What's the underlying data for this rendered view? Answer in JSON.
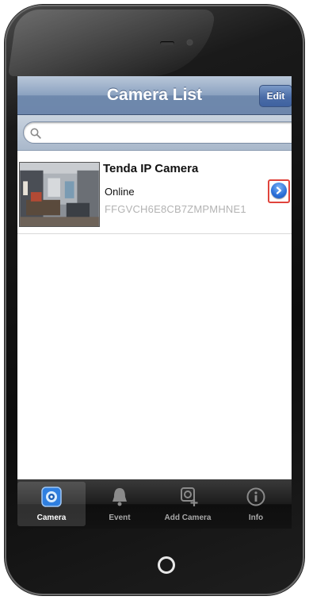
{
  "navbar": {
    "title": "Camera List",
    "edit_label": "Edit"
  },
  "search": {
    "placeholder": "",
    "value": ""
  },
  "cameras": [
    {
      "name": "Tenda IP Camera",
      "status": "Online",
      "id": "FFGVCH6E8CB7ZMPMHNE1"
    }
  ],
  "tabs": [
    {
      "label": "Camera",
      "icon": "camera-icon",
      "selected": true
    },
    {
      "label": "Event",
      "icon": "bell-icon",
      "selected": false
    },
    {
      "label": "Add Camera",
      "icon": "add-camera-icon",
      "selected": false
    },
    {
      "label": "Info",
      "icon": "info-icon",
      "selected": false
    }
  ],
  "colors": {
    "accent": "#2a6fd8",
    "highlight": "#e0443c",
    "navbar": "#7f97b9"
  }
}
